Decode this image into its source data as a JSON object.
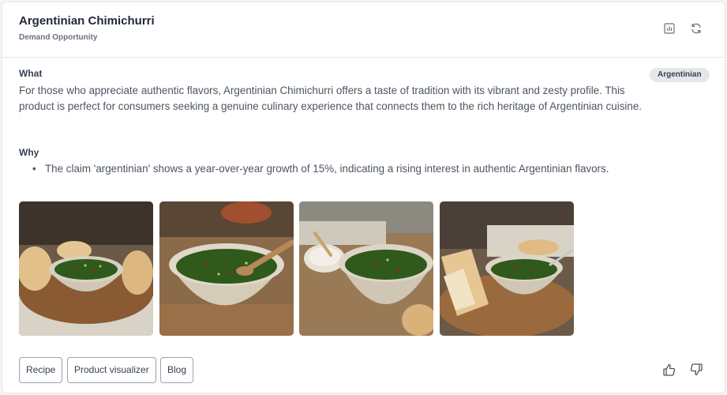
{
  "header": {
    "title": "Argentinian Chimichurri",
    "subtitle": "Demand Opportunity",
    "icons": [
      "chart-icon",
      "refresh-icon"
    ]
  },
  "tag": "Argentinian",
  "what": {
    "label": "What",
    "text": "For those who appreciate authentic flavors, Argentinian Chimichurri offers a taste of tradition with its vibrant and zesty profile. This product is perfect for consumers seeking a genuine culinary experience that connects them to the rich heritage of Argentinian cuisine."
  },
  "why": {
    "label": "Why",
    "items": [
      "The claim 'argentinian' shows a year-over-year growth of 15%, indicating a rising interest in authentic Argentinian flavors."
    ]
  },
  "images": [
    "chimichurri-bowl-bread",
    "chimichurri-bowl-spoon",
    "chimichurri-bowl-garlic",
    "chimichurri-bowl-baguette"
  ],
  "actions": {
    "recipe": "Recipe",
    "product_visualizer": "Product visualizer",
    "blog": "Blog"
  },
  "feedback_icons": [
    "thumbs-up-icon",
    "thumbs-down-icon"
  ],
  "colors": {
    "tag_bg": "#e5e7eb",
    "sauce_green": "#2f5a1b",
    "bowl": "#d8d0c0",
    "wood": "#8a5a33"
  }
}
